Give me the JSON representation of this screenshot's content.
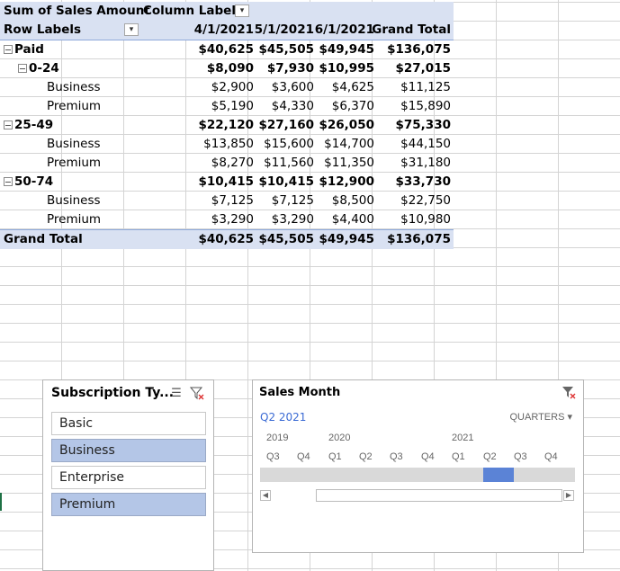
{
  "pivot": {
    "title": "Sum of Sales Amount",
    "column_labels": "Column Labels",
    "row_labels": "Row Labels",
    "columns": [
      "4/1/2021",
      "5/1/2021",
      "6/1/2021",
      "Grand Total"
    ],
    "rows": [
      {
        "label": "Paid",
        "values": [
          "$40,625",
          "$45,505",
          "$49,945",
          "$136,075"
        ]
      },
      {
        "label": "0-24",
        "values": [
          "$8,090",
          "$7,930",
          "$10,995",
          "$27,015"
        ]
      },
      {
        "label": "Business",
        "values": [
          "$2,900",
          "$3,600",
          "$4,625",
          "$11,125"
        ]
      },
      {
        "label": "Premium",
        "values": [
          "$5,190",
          "$4,330",
          "$6,370",
          "$15,890"
        ]
      },
      {
        "label": "25-49",
        "values": [
          "$22,120",
          "$27,160",
          "$26,050",
          "$75,330"
        ]
      },
      {
        "label": "Business",
        "values": [
          "$13,850",
          "$15,600",
          "$14,700",
          "$44,150"
        ]
      },
      {
        "label": "Premium",
        "values": [
          "$8,270",
          "$11,560",
          "$11,350",
          "$31,180"
        ]
      },
      {
        "label": "50-74",
        "values": [
          "$10,415",
          "$10,415",
          "$12,900",
          "$33,730"
        ]
      },
      {
        "label": "Business",
        "values": [
          "$7,125",
          "$7,125",
          "$8,500",
          "$22,750"
        ]
      },
      {
        "label": "Premium",
        "values": [
          "$3,290",
          "$3,290",
          "$4,400",
          "$10,980"
        ]
      }
    ],
    "grand_total": {
      "label": "Grand Total",
      "values": [
        "$40,625",
        "$45,505",
        "$49,945",
        "$136,075"
      ]
    }
  },
  "slicer": {
    "title": "Subscription Ty...",
    "items": [
      {
        "label": "Basic",
        "selected": false
      },
      {
        "label": "Business",
        "selected": true
      },
      {
        "label": "Enterprise",
        "selected": false
      },
      {
        "label": "Premium",
        "selected": true
      }
    ]
  },
  "timeline": {
    "title": "Sales Month",
    "period": "Q2 2021",
    "level": "QUARTERS",
    "years": [
      "2019",
      "2020",
      "2021"
    ],
    "quarters": [
      "Q3",
      "Q4",
      "Q1",
      "Q2",
      "Q3",
      "Q4",
      "Q1",
      "Q2",
      "Q3",
      "Q4"
    ],
    "selected_quarter_index": 7
  },
  "colors": {
    "pivot_header": "#d9e1f2",
    "slicer_selected": "#b4c6e7",
    "timeline_selected": "#5b83d6"
  }
}
